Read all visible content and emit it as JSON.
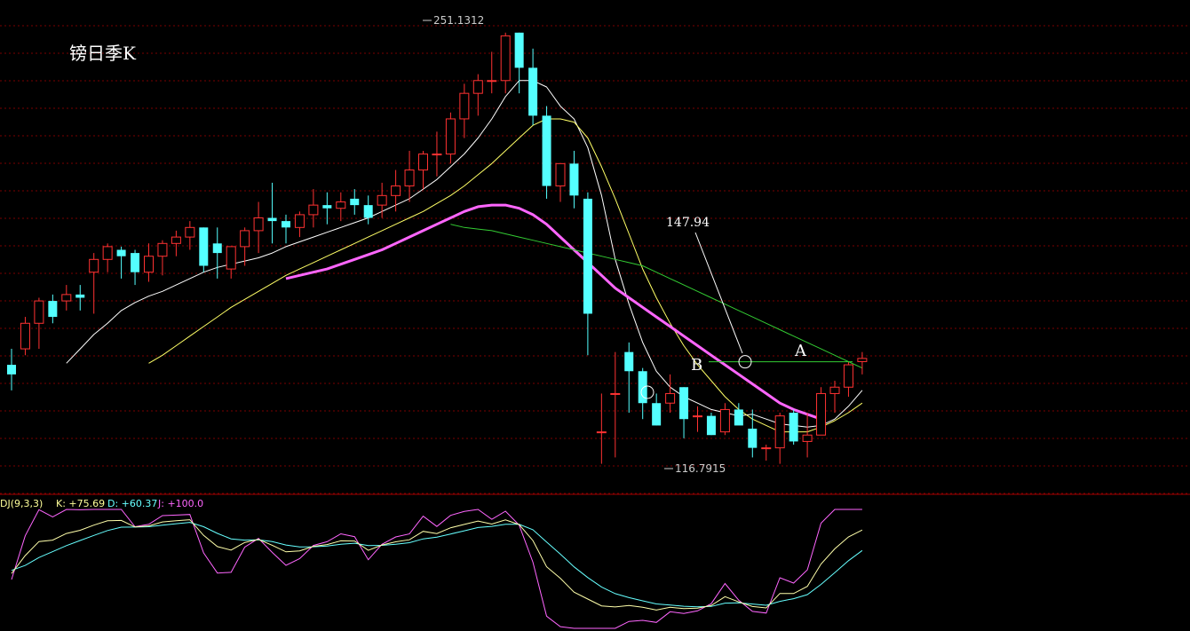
{
  "chart_data": {
    "type": "candlestick",
    "title": "镑日季K",
    "colors": {
      "up": "#ff3232",
      "down": "#54ffff",
      "ma_fast": "#ffffff",
      "ma_mid": "#ffff66",
      "ma_slow": "#ff66ff",
      "ma_long": "#33cc33",
      "grid": "#7a0000",
      "kdj_k": "#ffffaa",
      "kdj_d": "#66ffff",
      "kdj_j": "#ff66ff",
      "annotation_line": "#33cc33"
    },
    "price_range": [
      107,
      259
    ],
    "high_label": "251.1312",
    "low_label": "116.7915",
    "annotation_value": "147.94",
    "annotation_price": 147.94,
    "label_a": "A",
    "label_b": "B",
    "candles": [
      [
        147,
        152,
        139,
        144
      ],
      [
        152,
        162,
        150,
        160
      ],
      [
        160,
        168,
        152,
        167
      ],
      [
        167,
        169,
        160,
        162
      ],
      [
        167,
        172,
        164,
        169
      ],
      [
        169,
        172,
        164,
        168
      ],
      [
        176,
        182,
        163,
        180
      ],
      [
        180,
        185,
        176,
        184
      ],
      [
        183,
        184,
        174,
        181
      ],
      [
        182,
        183,
        172,
        176
      ],
      [
        176,
        185,
        173,
        181
      ],
      [
        181,
        186,
        175,
        185
      ],
      [
        185,
        189,
        181,
        187
      ],
      [
        187,
        192,
        183,
        190
      ],
      [
        190,
        190,
        176,
        178
      ],
      [
        185,
        190,
        174,
        182
      ],
      [
        177,
        183,
        174,
        184
      ],
      [
        184,
        190,
        178,
        189
      ],
      [
        189,
        198,
        182,
        193
      ],
      [
        193,
        204,
        185,
        192
      ],
      [
        192,
        194,
        185,
        190
      ],
      [
        190,
        195,
        187,
        194
      ],
      [
        194,
        202,
        190,
        197
      ],
      [
        197,
        201,
        191,
        196
      ],
      [
        196,
        201,
        192,
        198
      ],
      [
        199,
        202,
        194,
        197
      ],
      [
        197,
        200,
        191,
        193
      ],
      [
        197,
        204,
        193,
        200
      ],
      [
        200,
        208,
        195,
        203
      ],
      [
        203,
        214,
        198,
        208
      ],
      [
        208,
        214,
        202,
        213
      ],
      [
        213,
        220,
        206,
        213
      ],
      [
        213,
        226,
        210,
        224
      ],
      [
        224,
        235,
        218,
        232
      ],
      [
        232,
        238,
        225,
        236
      ],
      [
        236,
        245,
        232,
        236
      ],
      [
        236,
        251,
        232,
        250
      ],
      [
        251,
        251,
        232,
        240
      ],
      [
        240,
        246,
        222,
        225
      ],
      [
        225,
        228,
        199,
        203
      ],
      [
        203,
        210,
        198,
        210
      ],
      [
        210,
        214,
        196,
        200
      ],
      [
        199,
        201,
        150,
        163
      ],
      [
        126,
        138,
        116,
        126
      ],
      [
        138,
        151,
        118,
        138
      ],
      [
        151,
        154,
        132,
        145
      ],
      [
        145,
        146,
        130,
        135
      ],
      [
        135,
        138,
        128,
        128
      ],
      [
        135,
        144,
        132,
        138
      ],
      [
        140,
        140,
        124,
        130
      ],
      [
        131,
        134,
        126,
        131
      ],
      [
        131,
        132,
        125,
        125
      ],
      [
        126,
        135,
        125,
        133
      ],
      [
        133,
        135,
        129,
        128
      ],
      [
        127,
        133,
        118,
        121
      ],
      [
        121,
        122,
        117,
        121
      ],
      [
        121,
        132,
        116,
        131
      ],
      [
        132,
        133,
        122,
        123
      ],
      [
        123,
        132,
        118,
        125
      ],
      [
        125,
        140,
        125,
        138
      ],
      [
        138,
        142,
        132,
        140
      ],
      [
        140,
        148,
        137,
        147
      ],
      [
        148,
        151,
        144,
        149
      ]
    ],
    "ma_fast": [
      null,
      null,
      null,
      null,
      147.5,
      152,
      156.5,
      160,
      164,
      166.5,
      168.5,
      170,
      172,
      174,
      176,
      177.5,
      178.5,
      179.5,
      180.5,
      182,
      184,
      185.5,
      187,
      188.5,
      190,
      191.5,
      193,
      195,
      197,
      199,
      202,
      205,
      209,
      213,
      218,
      224,
      231,
      236,
      236,
      234,
      228,
      224,
      215,
      200,
      180,
      166,
      154,
      145,
      140,
      137,
      135,
      133,
      132,
      131,
      131.5,
      130,
      128.5,
      128,
      127.5,
      128,
      130,
      134,
      139
    ],
    "ma_mid": [
      null,
      null,
      null,
      null,
      null,
      null,
      null,
      null,
      null,
      null,
      147.5,
      150,
      153,
      156,
      159,
      162,
      165,
      167.5,
      170,
      172.5,
      175,
      177,
      179,
      181,
      183,
      185,
      187,
      189,
      191,
      193,
      195,
      197.5,
      200,
      203,
      206.5,
      210,
      214,
      218,
      222,
      224,
      224,
      223,
      218,
      209,
      199,
      188,
      177,
      168,
      160,
      153,
      147,
      142,
      137,
      133,
      130,
      128,
      126,
      126,
      126,
      127.5,
      129.5,
      132,
      135
    ],
    "ma_slow": [
      null,
      null,
      null,
      null,
      null,
      null,
      null,
      null,
      null,
      null,
      null,
      null,
      null,
      null,
      null,
      null,
      null,
      null,
      null,
      null,
      174,
      175,
      176,
      177,
      178.5,
      180,
      181.5,
      183,
      185,
      187,
      189,
      191,
      193,
      195,
      196.5,
      197,
      197,
      196,
      194,
      191,
      187,
      183,
      179,
      175,
      171,
      168,
      165,
      162,
      159,
      156,
      153,
      150,
      147,
      144,
      141,
      138,
      135,
      133,
      131.5,
      130
    ]
  },
  "kdj": {
    "label": "DJ(9,3,3)",
    "k_label": "K: +75.69",
    "d_label": "D: +60.37",
    "j_label": "J: +100.0"
  }
}
